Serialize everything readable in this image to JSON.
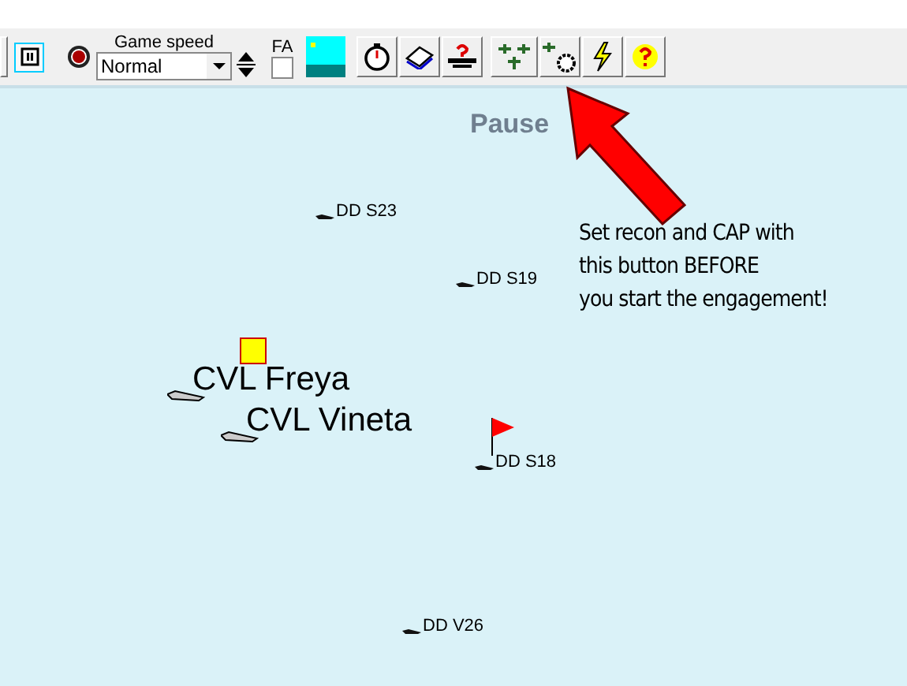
{
  "toolbar": {
    "speed_label": "Game speed",
    "speed_value": "Normal",
    "fa_label": "FA",
    "fa_checked": false,
    "buttons": [
      {
        "kind": "stopwatch"
      },
      {
        "kind": "book"
      },
      {
        "kind": "help-ship"
      },
      {
        "kind": "planes"
      },
      {
        "kind": "recon"
      },
      {
        "kind": "lightning"
      },
      {
        "kind": "help"
      }
    ]
  },
  "map": {
    "status": "Pause",
    "note": [
      "Set recon and CAP with",
      "this button BEFORE",
      "you start the engagement!"
    ],
    "ships": [
      {
        "label": "DD S23",
        "kind": "destroyer",
        "selected": false,
        "flag": false
      },
      {
        "label": "DD S19",
        "kind": "destroyer",
        "selected": false,
        "flag": false
      },
      {
        "label": "CVL Freya",
        "kind": "carrier",
        "selected": true,
        "flag": false
      },
      {
        "label": "CVL Vineta",
        "kind": "carrier",
        "selected": false,
        "flag": false
      },
      {
        "label": "DD S18",
        "kind": "destroyer",
        "selected": false,
        "flag": true
      },
      {
        "label": "DD V26",
        "kind": "destroyer",
        "selected": false,
        "flag": false
      }
    ]
  }
}
